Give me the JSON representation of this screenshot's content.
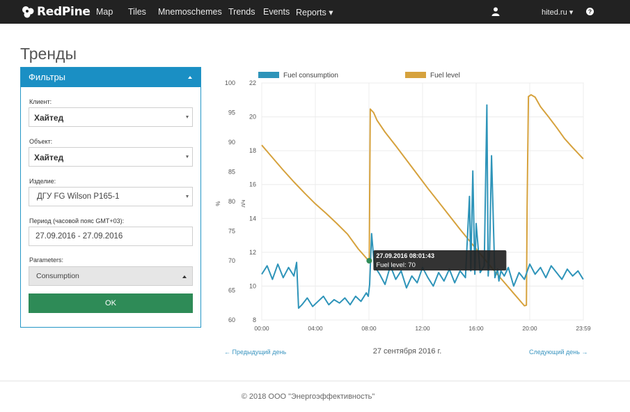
{
  "navbar": {
    "brand": "RedPine",
    "items": [
      "Map",
      "Tiles",
      "Mnemoschemes",
      "Trends",
      "Events",
      "Reports ▾"
    ],
    "user_menu": "hited.ru ▾",
    "icons": {
      "user": "user-icon",
      "help": "question-icon",
      "logo": "redpine-logo-icon"
    }
  },
  "page": {
    "title": "Тренды"
  },
  "filters": {
    "title": "Фильтры",
    "client": {
      "label": "Клиент:",
      "value": "Хайтед"
    },
    "object": {
      "label": "Объект:",
      "value": "Хайтед"
    },
    "product": {
      "label": "Изделие:",
      "value": "ДГУ FG Wilson P165-1"
    },
    "period": {
      "label": "Период (часовой пояс GMT+03):",
      "value": "27.09.2016 - 27.09.2016"
    },
    "parameters": {
      "label": "Parameters:",
      "value": "Consumption"
    },
    "ok_label": "OK"
  },
  "navigation": {
    "prev": "← Предыдущий день",
    "date": "27 сентября 2016 г.",
    "next": "Следующий день →"
  },
  "footer": {
    "text": "© 2018 ООО \"Энергоэффективность\""
  },
  "chart_data": {
    "type": "line",
    "x_unit": "time of day (hours)",
    "x_ticks": [
      "00:00",
      "04:00",
      "08:00",
      "12:00",
      "16:00",
      "20:00",
      "23:59"
    ],
    "xlim": [
      0,
      24
    ],
    "y_left": {
      "label": "%",
      "ylim": [
        60,
        100
      ],
      "ticks": [
        60,
        65,
        70,
        75,
        80,
        85,
        90,
        95,
        100
      ]
    },
    "y_right": {
      "label": "л/ч",
      "ylim": [
        8,
        22
      ],
      "ticks": [
        8,
        10,
        12,
        14,
        16,
        18,
        20,
        22
      ]
    },
    "legend": {
      "placement": "top",
      "entries": [
        "Fuel consumption",
        "Fuel level"
      ]
    },
    "grid": true,
    "colors": {
      "consumption": "#2e94b9",
      "level": "#d6a23d",
      "tooltip_bg": "#222222",
      "marker": "#2e8b57"
    },
    "series": [
      {
        "name": "Fuel level",
        "axis": "left",
        "x": [
          0,
          0.8,
          1.6,
          2.4,
          3.2,
          4.0,
          4.8,
          5.6,
          6.4,
          7.2,
          7.9,
          8.02,
          8.1,
          8.35,
          8.6,
          9.2,
          10.0,
          10.8,
          11.6,
          12.4,
          13.2,
          14.0,
          14.8,
          15.6,
          16.4,
          17.2,
          18.0,
          18.8,
          19.6,
          19.75,
          19.8,
          19.9,
          20.1,
          20.4,
          20.8,
          21.4,
          22.0,
          22.6,
          23.2,
          23.99
        ],
        "values": [
          89.5,
          87.4,
          85.3,
          83.3,
          81.4,
          79.6,
          78.0,
          76.3,
          74.5,
          72.0,
          70.2,
          70,
          95.6,
          95.0,
          93.7,
          91.7,
          89.4,
          87.0,
          84.6,
          82.2,
          79.9,
          77.6,
          75.3,
          73.1,
          70.9,
          68.7,
          66.6,
          64.5,
          62.4,
          62.5,
          79.0,
          97.7,
          98.0,
          97.6,
          96.0,
          94.3,
          92.5,
          90.6,
          89.1,
          87.2
        ]
      },
      {
        "name": "Fuel consumption",
        "axis": "right",
        "x": [
          0,
          0.4,
          0.8,
          1.2,
          1.6,
          2.0,
          2.4,
          2.6,
          2.75,
          3.0,
          3.4,
          3.8,
          4.2,
          4.6,
          5.0,
          5.4,
          5.8,
          6.2,
          6.6,
          7.0,
          7.4,
          7.8,
          7.95,
          8.05,
          8.2,
          8.4,
          8.8,
          9.2,
          9.6,
          10.0,
          10.4,
          10.8,
          11.2,
          11.6,
          12.0,
          12.4,
          12.8,
          13.2,
          13.6,
          14.0,
          14.4,
          14.8,
          15.2,
          15.5,
          15.6,
          15.75,
          15.9,
          16.0,
          16.3,
          16.6,
          16.8,
          16.9,
          17.0,
          17.15,
          17.4,
          17.6,
          17.7,
          17.85,
          18.1,
          18.4,
          18.8,
          19.2,
          19.6,
          20.0,
          20.4,
          20.8,
          21.2,
          21.6,
          22.0,
          22.4,
          22.8,
          23.2,
          23.6,
          23.99
        ],
        "values": [
          10.7,
          11.2,
          10.4,
          11.3,
          10.5,
          11.1,
          10.6,
          11.4,
          8.7,
          8.9,
          9.3,
          8.8,
          9.1,
          9.4,
          8.9,
          9.2,
          9.0,
          9.3,
          8.9,
          9.4,
          9.1,
          9.6,
          9.4,
          10.1,
          13.1,
          11.2,
          10.7,
          10.1,
          11.2,
          10.4,
          10.9,
          9.9,
          10.6,
          10.2,
          11.1,
          10.5,
          10.0,
          10.8,
          10.3,
          11.0,
          10.2,
          10.9,
          10.5,
          15.3,
          10.9,
          16.8,
          10.7,
          13.7,
          10.8,
          11.2,
          20.7,
          10.6,
          12.0,
          17.7,
          10.5,
          11.0,
          10.3,
          10.9,
          10.6,
          11.1,
          10.0,
          10.8,
          10.4,
          11.3,
          10.7,
          11.1,
          10.5,
          11.2,
          10.8,
          10.4,
          11.0,
          10.6,
          10.9,
          10.4
        ]
      }
    ],
    "tooltip": {
      "title": "27.09.2016 08:01:43",
      "line": "Fuel level: 70",
      "x": 8.02,
      "value": 70
    }
  }
}
